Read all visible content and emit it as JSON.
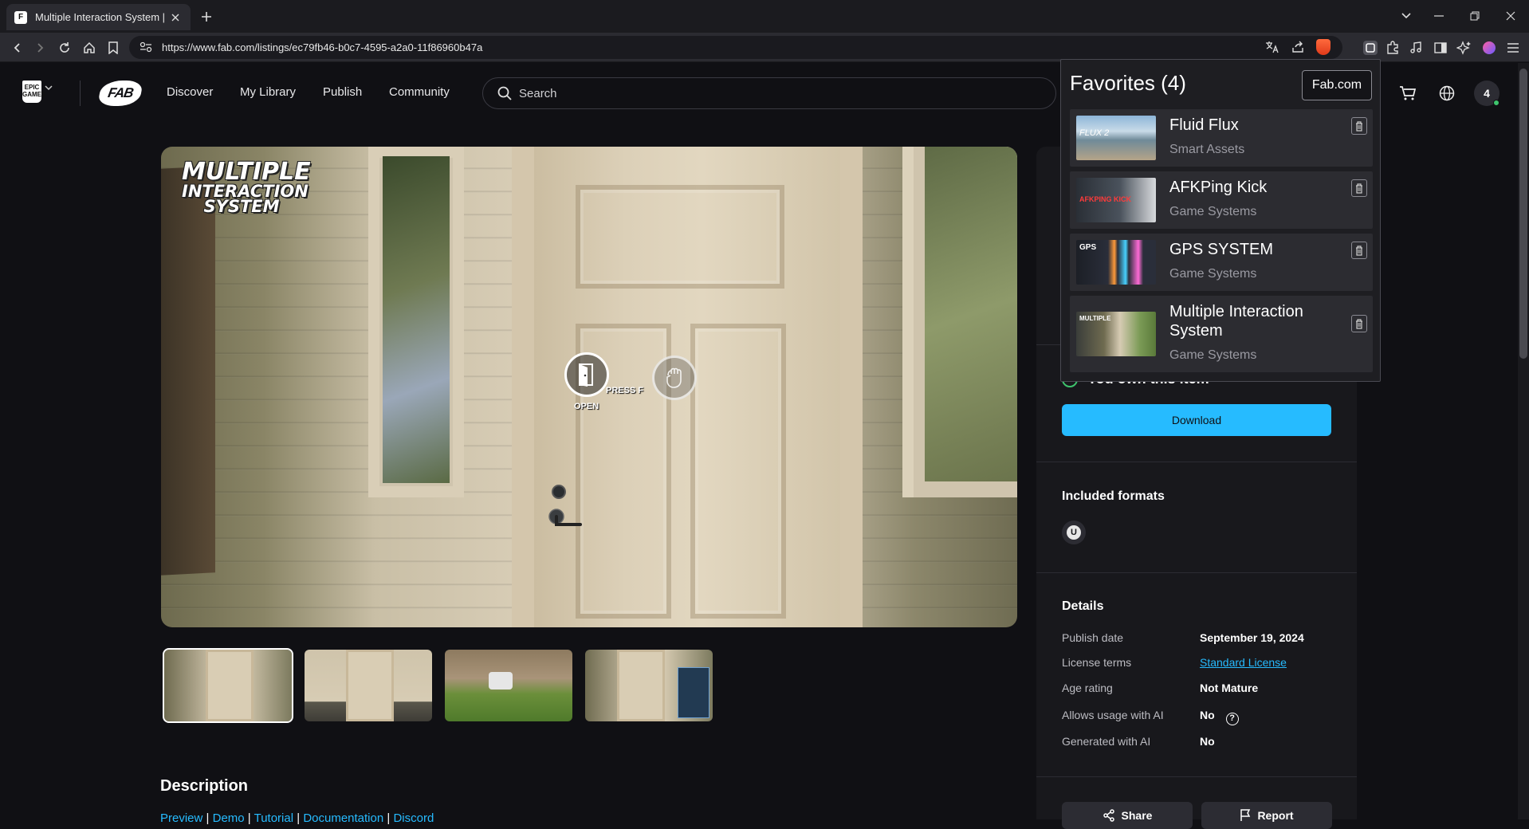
{
  "browser": {
    "tab_title": "Multiple Interaction System | Fab",
    "url": "https://www.fab.com/listings/ec79fb46-b0c7-4595-a2a0-11f86960b47a"
  },
  "header": {
    "nav": [
      "Discover",
      "My Library",
      "Publish",
      "Community"
    ],
    "search_placeholder": "Search",
    "notification_count": "4"
  },
  "hero": {
    "title_lines": [
      "MULTIPLE",
      "INTERACTION",
      "SYSTEM"
    ],
    "open_label": "OPEN",
    "press_label": "PRESS F"
  },
  "description": {
    "title": "Description",
    "links": [
      "Preview",
      "Demo",
      "Tutorial",
      "Documentation",
      "Discord"
    ]
  },
  "sidebar": {
    "owned_text": "You own this item",
    "download_label": "Download",
    "formats_heading": "Included formats",
    "format_icon": "unreal-engine-icon",
    "details_heading": "Details",
    "details": [
      {
        "label": "Publish date",
        "value": "September 19, 2024"
      },
      {
        "label": "License terms",
        "value": "Standard License"
      },
      {
        "label": "Age rating",
        "value": "Not Mature"
      },
      {
        "label": "Allows usage with AI",
        "value": "No"
      },
      {
        "label": "Generated with AI",
        "value": "No"
      }
    ],
    "share_label": "Share",
    "report_label": "Report"
  },
  "favorites": {
    "title": "Favorites (4)",
    "site_button": "Fab.com",
    "items": [
      {
        "name": "Fluid Flux",
        "category": "Smart Assets"
      },
      {
        "name": "AFKPing Kick",
        "category": "Game Systems"
      },
      {
        "name": "GPS SYSTEM",
        "category": "Game Systems"
      },
      {
        "name": "Multiple Interaction System",
        "category": "Game Systems"
      }
    ],
    "thumb_texts": [
      "FLUX 2",
      "AFKPING KICK",
      "GPS",
      "MULTIPLE"
    ]
  },
  "colors": {
    "accent": "#26bbff",
    "background": "#101014",
    "panel": "#18181c",
    "online": "#3ec46d"
  }
}
